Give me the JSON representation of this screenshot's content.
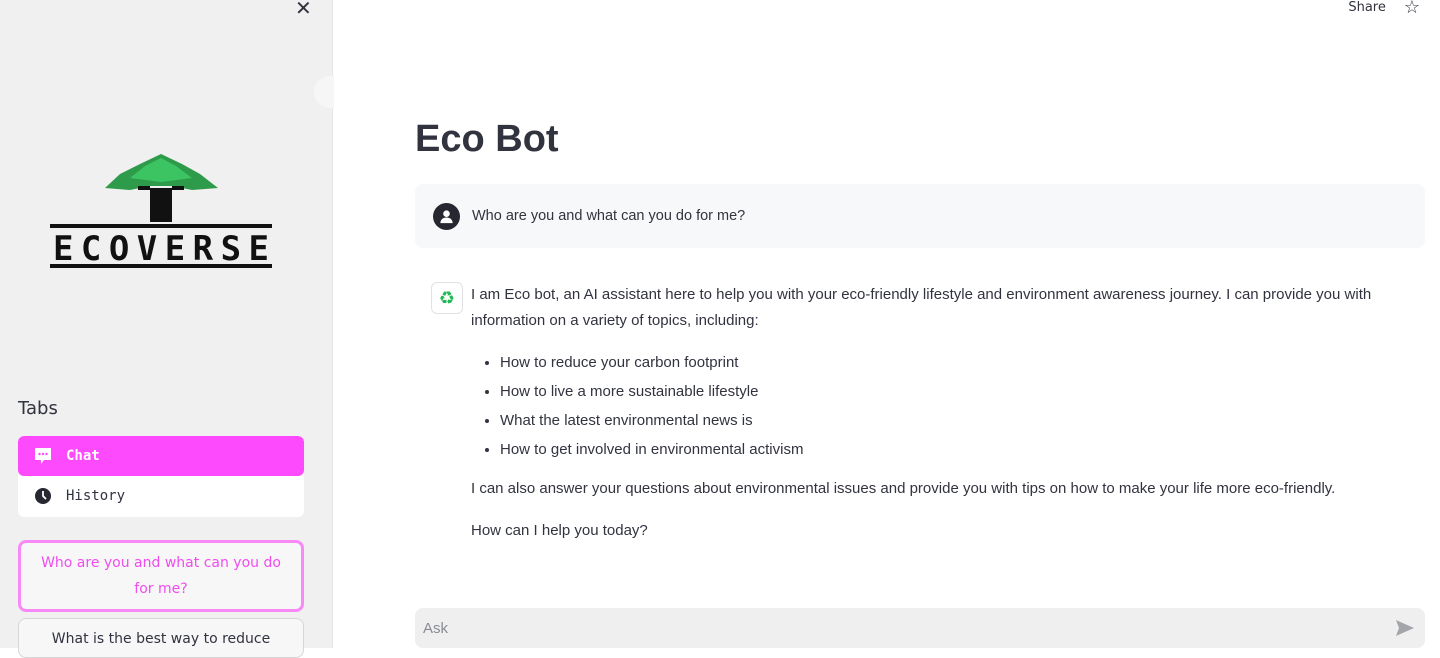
{
  "sidebar": {
    "logo_text": "ECOVERSE",
    "tabs_title": "Tabs",
    "tabs": [
      {
        "label": "Chat",
        "icon": "chat-icon",
        "active": true
      },
      {
        "label": "History",
        "icon": "clock-icon",
        "active": false
      }
    ],
    "suggestions": [
      "Who are you and what can you do for me?",
      "What is the best way to reduce carbon"
    ],
    "accent": "#fd4afd"
  },
  "header": {
    "share_label": "Share"
  },
  "main": {
    "title": "Eco Bot",
    "user_message": "Who are you and what can you do for me?",
    "bot_message": {
      "intro": "I am Eco bot, an AI assistant here to help you with your eco-friendly lifestyle and environment awareness journey. I can provide you with information on a variety of topics, including:",
      "items": [
        "How to reduce your carbon footprint",
        "How to live a more sustainable lifestyle",
        "What the latest environmental news is",
        "How to get involved in environmental activism"
      ],
      "para2": "I can also answer your questions about environmental issues and provide you with tips on how to make your life more eco-friendly.",
      "para3": "How can I help you today?"
    },
    "chat_input": {
      "placeholder": "Ask",
      "value": ""
    }
  }
}
